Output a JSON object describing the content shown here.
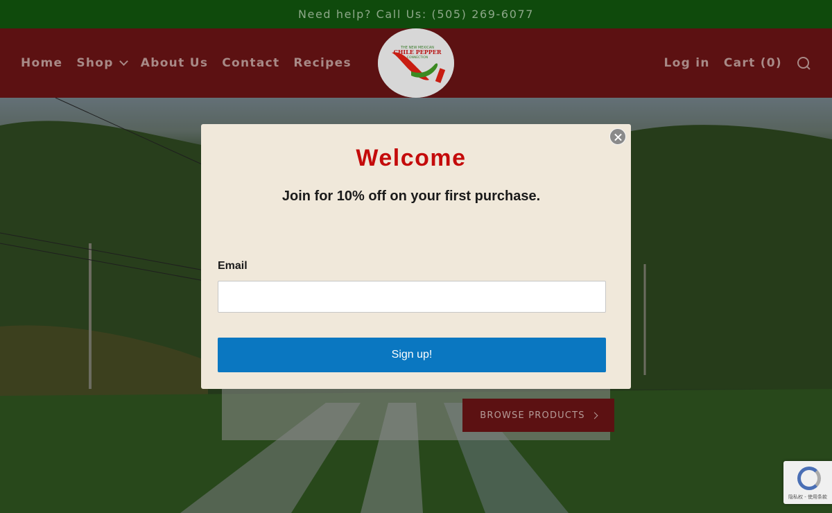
{
  "topbar": {
    "text": "Need help? Call Us: (505) 269-6077"
  },
  "nav": {
    "left": [
      {
        "label": "Home"
      },
      {
        "label": "Shop"
      },
      {
        "label": "About Us"
      },
      {
        "label": "Contact"
      },
      {
        "label": "Recipes"
      }
    ],
    "login": "Log in",
    "cart": "Cart (0)"
  },
  "logo": {
    "line1": "THE NEW MEXICAN",
    "line2": "CHILE PEPPER",
    "line3": "CONNECTION"
  },
  "hero": {
    "browse_label": "BROWSE PRODUCTS"
  },
  "modal": {
    "title": "Welcome",
    "subtitle": "Join for 10% off on your first purchase.",
    "email_label": "Email",
    "email_value": "",
    "submit_label": "Sign up!"
  },
  "recaptcha": {
    "footer_text": "隐私权 - 使用条款"
  },
  "colors": {
    "topbar_bg": "#0f4a0c",
    "header_bg": "#5c1112",
    "modal_bg": "#f0e8da",
    "title_red": "#c40b0b",
    "signup_blue": "#0a77c1"
  }
}
